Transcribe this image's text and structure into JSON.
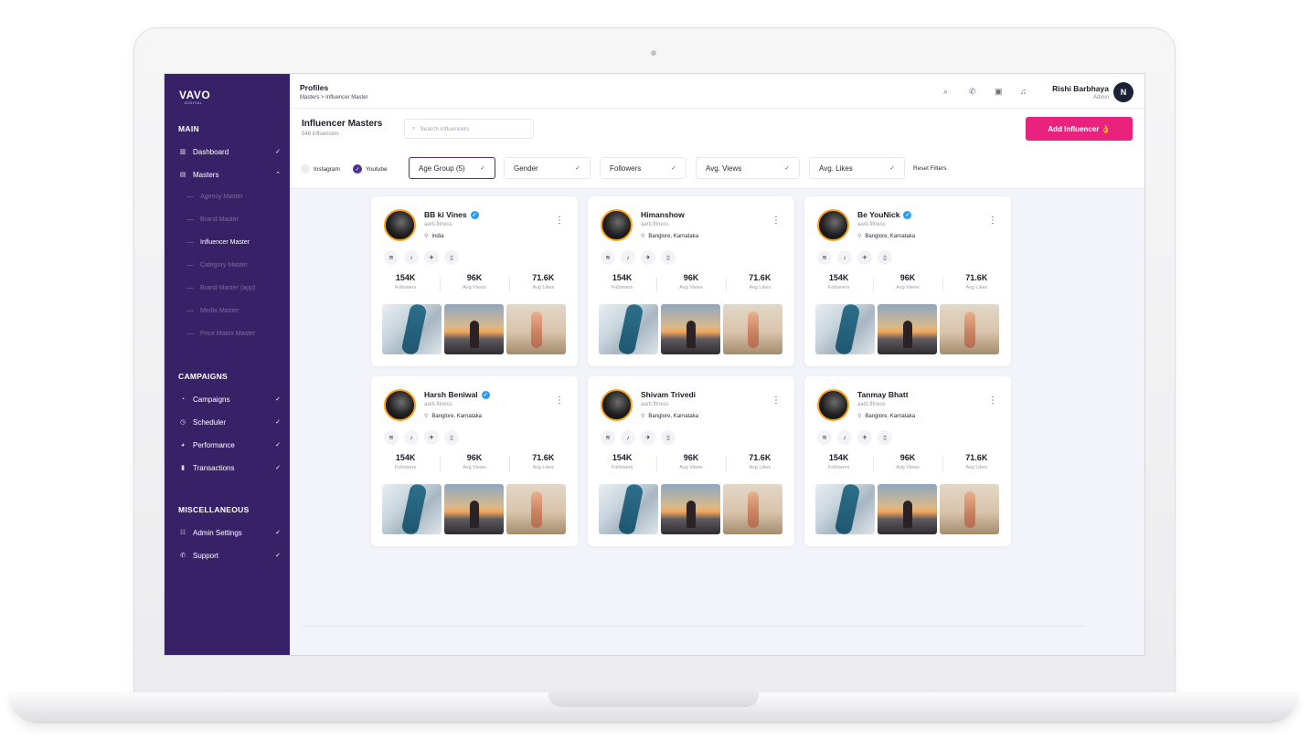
{
  "sidebar": {
    "logo": "VAVO",
    "logo_sub": "DIGITAL",
    "sections": {
      "main": "MAIN",
      "campaigns": "CAMPAIGNS",
      "misc": "MISCELLANEOUS"
    },
    "main_items": [
      {
        "label": "Dashboard",
        "icon": "chart-icon"
      },
      {
        "label": "Masters",
        "icon": "table-icon"
      }
    ],
    "master_subitems": [
      "Agency Master",
      "Brand Master",
      "Influencer Master",
      "Category Master",
      "Brand Master (app)",
      "Media Master",
      "Price Matrix Master"
    ],
    "campaign_items": [
      {
        "label": "Campaigns",
        "icon": "megaphone-icon"
      },
      {
        "label": "Scheduler",
        "icon": "clock-icon"
      },
      {
        "label": "Performance",
        "icon": "pie-icon"
      },
      {
        "label": "Transactions",
        "icon": "receipt-icon"
      }
    ],
    "misc_items": [
      {
        "label": "Admin Settings",
        "icon": "sliders-icon"
      },
      {
        "label": "Support",
        "icon": "phone-icon"
      }
    ]
  },
  "topbar": {
    "title": "Profiles",
    "breadcrumb": "Masters > Influencer Master",
    "user_name": "Rishi Barbhaya",
    "user_role": "Admin",
    "avatar_letter": "N"
  },
  "header": {
    "title": "Influencer Masters",
    "count": "548 influencers",
    "search_placeholder": "Search influencers",
    "add_button": "Add Influencer 👌"
  },
  "filters": {
    "platforms": [
      {
        "label": "Instagram",
        "selected": false
      },
      {
        "label": "Youtube",
        "selected": true
      }
    ],
    "dropdowns": [
      "Age Group (5)",
      "Gender",
      "Followers",
      "Avg. Views",
      "Avg. Likes"
    ],
    "reset": "Reset Filters"
  },
  "stat_labels": [
    "Followers",
    "Avg Views",
    "Avg Likes"
  ],
  "cards": [
    {
      "name": "BB ki Vines",
      "verified": true,
      "handle": "aarti.fitness",
      "location": "India",
      "stats": [
        "154K",
        "96K",
        "71.6K"
      ]
    },
    {
      "name": "Himanshow",
      "verified": false,
      "handle": "aarti.fitness",
      "location": "Banglore, Karnataka",
      "stats": [
        "154K",
        "96K",
        "71.6K"
      ]
    },
    {
      "name": "Be YouNick",
      "verified": true,
      "handle": "aarti.fitness",
      "location": "Banglore, Karnataka",
      "stats": [
        "154K",
        "96K",
        "71.6K"
      ]
    },
    {
      "name": "Harsh Beniwal",
      "verified": true,
      "handle": "aarti.fitness",
      "location": "Banglore, Karnataka",
      "stats": [
        "154K",
        "96K",
        "71.6K"
      ]
    },
    {
      "name": "Shivam Trivedi",
      "verified": false,
      "handle": "aarti.fitness",
      "location": "Banglore, Karnataka",
      "stats": [
        "154K",
        "96K",
        "71.6K"
      ]
    },
    {
      "name": "Tanmay Bhatt",
      "verified": false,
      "handle": "aarti.fitness",
      "location": "Banglore, Karnataka",
      "stats": [
        "154K",
        "96K",
        "71.6K"
      ]
    }
  ],
  "colors": {
    "sidebar_bg": "#372267",
    "accent": "#4a3192",
    "primary_button": "#e9237d",
    "verified": "#2d9cf0",
    "avatar_ring": "#ffa21a"
  }
}
